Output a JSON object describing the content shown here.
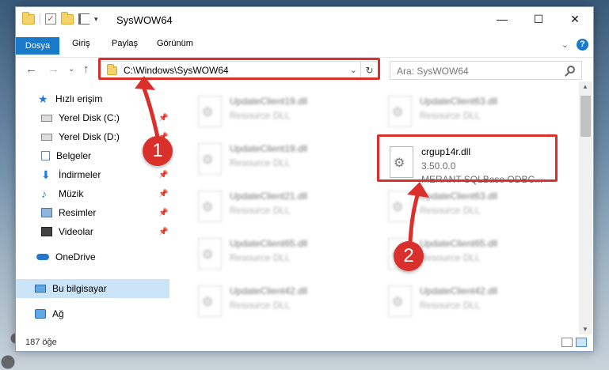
{
  "window": {
    "title": "SysWOW64",
    "controls": {
      "minimize": "—",
      "maximize": "☐",
      "close": "✕"
    }
  },
  "quick_access_toolbar": {
    "dropdown": "▾"
  },
  "ribbon": {
    "tabs": [
      "Dosya",
      "Giriş",
      "Paylaş",
      "Görünüm"
    ],
    "expand": "⌄",
    "help": "?"
  },
  "navigation": {
    "back": "←",
    "forward": "→",
    "recent": "⌄",
    "up": "↑",
    "address": "C:\\Windows\\SysWOW64",
    "address_dropdown": "⌄",
    "refresh": "↻",
    "search_placeholder": "Ara: SysWOW64"
  },
  "sidebar": {
    "items": [
      {
        "label": "Hızlı erişim",
        "icon": "star-icon",
        "pinned": false
      },
      {
        "label": "Yerel Disk (C:)",
        "icon": "drive-icon",
        "pinned": true
      },
      {
        "label": "Yerel Disk (D:)",
        "icon": "drive-icon",
        "pinned": true
      },
      {
        "label": "Belgeler",
        "icon": "documents-icon",
        "pinned": true
      },
      {
        "label": "İndirmeler",
        "icon": "download-icon",
        "pinned": true
      },
      {
        "label": "Müzik",
        "icon": "music-icon",
        "pinned": true
      },
      {
        "label": "Resimler",
        "icon": "pictures-icon",
        "pinned": true
      },
      {
        "label": "Videolar",
        "icon": "videos-icon",
        "pinned": true
      },
      {
        "label": "OneDrive",
        "icon": "cloud-icon",
        "pinned": false
      },
      {
        "label": "Bu bilgisayar",
        "icon": "computer-icon",
        "pinned": false,
        "selected": true
      },
      {
        "label": "Ağ",
        "icon": "network-icon",
        "pinned": false
      }
    ],
    "pin_glyph": "📌"
  },
  "files": [
    {
      "name": "UpdateClient19.dll",
      "type": "Resource DLL",
      "highlighted": false
    },
    {
      "name": "UpdateClient63.dll",
      "type": "Resource DLL",
      "highlighted": false
    },
    {
      "name": "UpdateClient19.dll",
      "type": "Resource DLL",
      "highlighted": false
    },
    {
      "name": "crgup14r.dll",
      "version": "3.50.0.0",
      "description": "MERANT SQLBase ODBC...",
      "highlighted": true
    },
    {
      "name": "UpdateClient21.dll",
      "type": "Resource DLL",
      "highlighted": false
    },
    {
      "name": "UpdateClient63.dll",
      "type": "Resource DLL",
      "highlighted": false
    },
    {
      "name": "UpdateClient65.dll",
      "type": "Resource DLL",
      "highlighted": false
    },
    {
      "name": "UpdateClient65.dll",
      "type": "Resource DLL",
      "highlighted": false
    },
    {
      "name": "UpdateClient42.dll",
      "type": "Resource DLL",
      "highlighted": false
    },
    {
      "name": "UpdateClient42.dll",
      "type": "Resource DLL",
      "highlighted": false
    }
  ],
  "status": {
    "item_count": "187 öğe"
  },
  "annotations": [
    {
      "number": "1",
      "color": "#d9302c"
    },
    {
      "number": "2",
      "color": "#d9302c"
    }
  ],
  "colors": {
    "accent": "#1979ca",
    "highlight": "#d9302c",
    "selected_bg": "#cce4f7"
  }
}
